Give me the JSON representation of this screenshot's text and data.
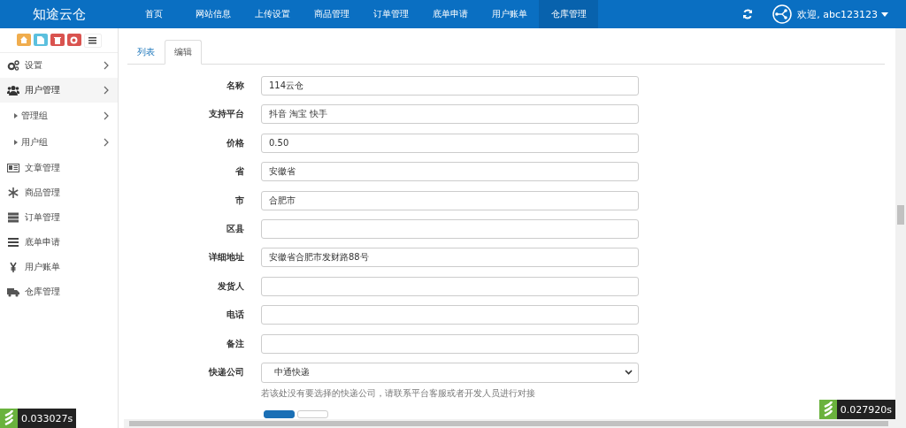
{
  "header": {
    "logo": "知途云仓",
    "nav": [
      {
        "label": "首页",
        "selected": false
      },
      {
        "label": "网站信息",
        "selected": false
      },
      {
        "label": "上传设置",
        "selected": false
      },
      {
        "label": "商品管理",
        "selected": false
      },
      {
        "label": "订单管理",
        "selected": false
      },
      {
        "label": "底单申请",
        "selected": false
      },
      {
        "label": "用户账单",
        "selected": false
      },
      {
        "label": "仓库管理",
        "selected": true
      }
    ],
    "user": "欢迎, abc123123"
  },
  "sidebar": {
    "items": [
      {
        "label": "设置",
        "selected": false,
        "kind": "group"
      },
      {
        "label": "用户管理",
        "selected": true,
        "kind": "group",
        "children": [
          {
            "label": "管理组"
          },
          {
            "label": "用户组"
          }
        ]
      },
      {
        "label": "文章管理",
        "selected": false,
        "kind": "link"
      },
      {
        "label": "商品管理",
        "selected": false,
        "kind": "link"
      },
      {
        "label": "订单管理",
        "selected": false,
        "kind": "link"
      },
      {
        "label": "底单申请",
        "selected": false,
        "kind": "link"
      },
      {
        "label": "用户账单",
        "selected": false,
        "kind": "link"
      },
      {
        "label": "仓库管理",
        "selected": false,
        "kind": "link"
      }
    ]
  },
  "tabs": [
    {
      "label": "列表",
      "selected": false
    },
    {
      "label": "编辑",
      "selected": true
    }
  ],
  "form": {
    "fields": [
      {
        "label": "名称",
        "kind": "text",
        "value": "114云仓"
      },
      {
        "label": "支持平台",
        "kind": "text",
        "value": "抖音 淘宝 快手"
      },
      {
        "label": "价格",
        "kind": "text",
        "value": "0.50"
      },
      {
        "label": "省",
        "kind": "text",
        "value": "安徽省"
      },
      {
        "label": "市",
        "kind": "text",
        "value": "合肥市"
      },
      {
        "label": "区县",
        "kind": "text"
      },
      {
        "label": "详细地址",
        "kind": "text",
        "value": "安徽省合肥市发财路88号"
      },
      {
        "label": "发货人",
        "kind": "text"
      },
      {
        "label": "电话",
        "kind": "text"
      },
      {
        "label": "备注",
        "kind": "text"
      },
      {
        "label": "快递公司",
        "kind": "select",
        "value": "中通快递",
        "help": "若该处没有要选择的快递公司，请联系平台客服或者开发人员进行对接"
      }
    ]
  },
  "timers": [
    "0.033027s",
    "0.027920s"
  ]
}
